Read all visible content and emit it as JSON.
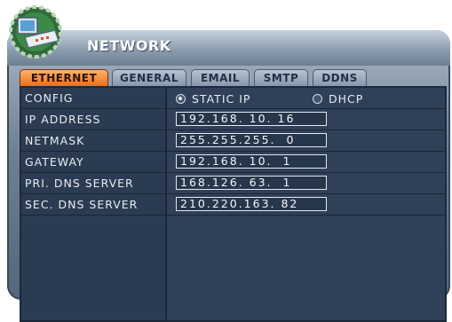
{
  "window": {
    "title": "NETWORK"
  },
  "tabs": [
    {
      "label": "ETHERNET",
      "active": true
    },
    {
      "label": "GENERAL",
      "active": false
    },
    {
      "label": "EMAIL",
      "active": false
    },
    {
      "label": "SMTP",
      "active": false
    },
    {
      "label": "DDNS",
      "active": false
    }
  ],
  "settings": {
    "config": {
      "label": "CONFIG",
      "options": [
        "STATIC IP",
        "DHCP"
      ],
      "selected": "STATIC IP"
    },
    "ip_address": {
      "label": "IP ADDRESS",
      "value": "192.168. 10. 16"
    },
    "netmask": {
      "label": "NETMASK",
      "value": "255.255.255.  0"
    },
    "gateway": {
      "label": "GATEWAY",
      "value": "192.168. 10.  1"
    },
    "pri_dns": {
      "label": "PRI. DNS SERVER",
      "value": "168.126. 63.  1"
    },
    "sec_dns": {
      "label": "SEC. DNS SERVER",
      "value": "210.220.163. 82"
    }
  },
  "icons": {
    "logo": "network-device-icon"
  },
  "colors": {
    "active_tab": "#e96f1e",
    "panel": "#2c3d53",
    "text": "#e8ecf2"
  }
}
